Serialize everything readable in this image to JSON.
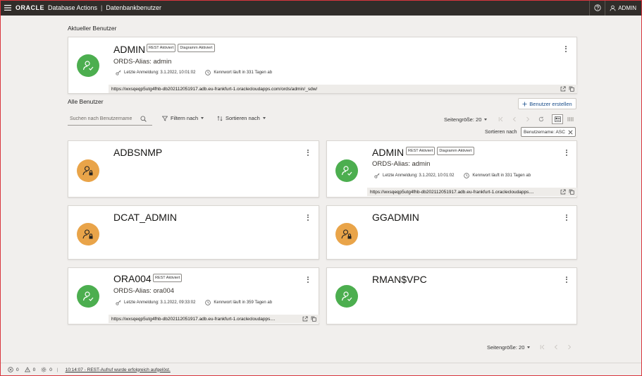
{
  "header": {
    "logo": "ORACLE",
    "app_name": "Database Actions",
    "separator": "|",
    "page_name": "Datenbankbenutzer",
    "user_label": "ADMIN"
  },
  "current_user_section": {
    "title": "Aktueller Benutzer"
  },
  "current_user": {
    "name": "ADMIN",
    "badges": [
      "REST Aktiviert",
      "Diagramm Aktiviert"
    ],
    "alias": "ORDS-Alias: admin",
    "last_login": "Letzte Anmeldung: 3.1.2022, 10:01:02",
    "password_expiry": "Kennwort läuft in 331 Tagen ab",
    "url": "https://wxsqeqp5utg4fhb-db202112051917.adb.eu-frankfurt-1.oraclecloudapps.com/ords/admin/_sdw/"
  },
  "all_users_section": {
    "title": "Alle Benutzer",
    "create_button": "Benutzer erstellen",
    "search_placeholder": "Suchen nach Benutzername",
    "filter_label": "Filtern nach",
    "sort_label": "Sortieren nach",
    "page_size": "Seitengröße: 20",
    "sort_by_label": "Sortieren nach",
    "sort_chip": "Benutzername: ASC"
  },
  "users": [
    {
      "name": "ADBSNMP",
      "status": "locked",
      "color": "#e9a449"
    },
    {
      "name": "ADMIN",
      "status": "active",
      "color": "#4cae4f",
      "badges": [
        "REST Aktiviert",
        "Diagramm Aktiviert"
      ],
      "alias": "ORDS-Alias: admin",
      "last_login": "Letzte Anmeldung: 3.1.2022, 10:01:02",
      "password_expiry": "Kennwort läuft in 331 Tagen ab",
      "url": "https://wxsqeqp5utg4fhb-db202112051917.adb.eu-frankfurt-1.oraclecloudapps...."
    },
    {
      "name": "DCAT_ADMIN",
      "status": "locked",
      "color": "#e9a449"
    },
    {
      "name": "GGADMIN",
      "status": "locked",
      "color": "#e9a449"
    },
    {
      "name": "ORA004",
      "status": "active",
      "color": "#4cae4f",
      "badges": [
        "REST Aktiviert"
      ],
      "alias": "ORDS-Alias: ora004",
      "last_login": "Letzte Anmeldung: 3.1.2022, 09:33:02",
      "password_expiry": "Kennwort läuft in 359 Tagen ab",
      "url": "https://wxsqeqp5utg4fhb-db202112051917.adb.eu-frankfurt-1.oraclecloudapps...."
    },
    {
      "name": "RMAN$VPC",
      "status": "active",
      "color": "#4cae4f"
    }
  ],
  "pagination_bottom": {
    "page_size": "Seitengröße: 20"
  },
  "footer": {
    "errors": "0",
    "warnings": "0",
    "tasks": "0",
    "separator": "|",
    "message": "10:14:07 - REST-Aufruf wurde erfolgreich aufgelöst."
  }
}
